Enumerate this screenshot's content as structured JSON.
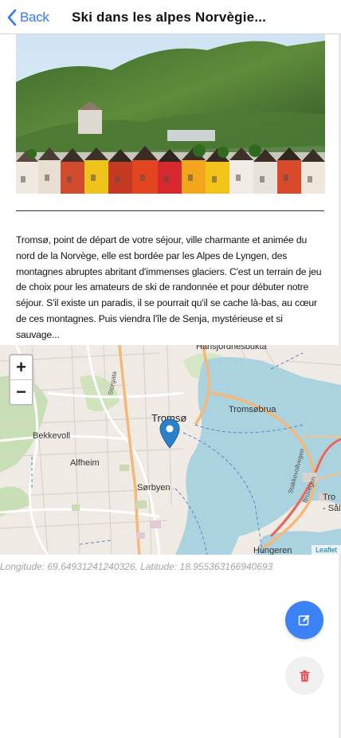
{
  "header": {
    "back_label": "Back",
    "title": "Ski dans les alpes Norvègie..."
  },
  "description": "Tromsø, point de départ de votre séjour, ville charmante et animée du nord de la Norvège, elle est bordée par les Alpes de Lyngen, des montagnes abruptes abritant d'immenses glaciers. C'est un terrain de jeu de choix pour les amateurs de ski de randonnée et pour débuter notre séjour. S'il existe un paradis, il se pourrait qu'il se cache là-bas, au cœur de ces montagnes. Puis viendra l'île de Senja, mystérieuse et si sauvage...",
  "map": {
    "zoom_in": "+",
    "zoom_out": "−",
    "labels": {
      "tromso": "Tromsø",
      "tromsobrua": "Tromsøbrua",
      "bekkevoll": "Bekkevoll",
      "alfheim": "Alfheim",
      "sorbyen": "Sørbyen",
      "hansjordnesbukta": "Hansjordnesbukta",
      "storgata": "Storgata",
      "stakkevollvegen": "Stakkevollvegen",
      "bruvegen": "Bruvegen",
      "tro": "Tro",
      "sal": "- Sål",
      "hungeren": "Hungeren"
    },
    "attribution": "Leaflet",
    "marker_icon": "map-marker-icon"
  },
  "coordinates": "Longitude: 69.64931241240326, Latitude: 18.955363166940693",
  "actions": {
    "edit_icon": "edit-icon",
    "delete_icon": "trash-icon"
  },
  "colors": {
    "accent": "#3478f6",
    "fab_edit": "#3b82f6",
    "delete_red": "#e5484d",
    "water": "#aad3df"
  }
}
